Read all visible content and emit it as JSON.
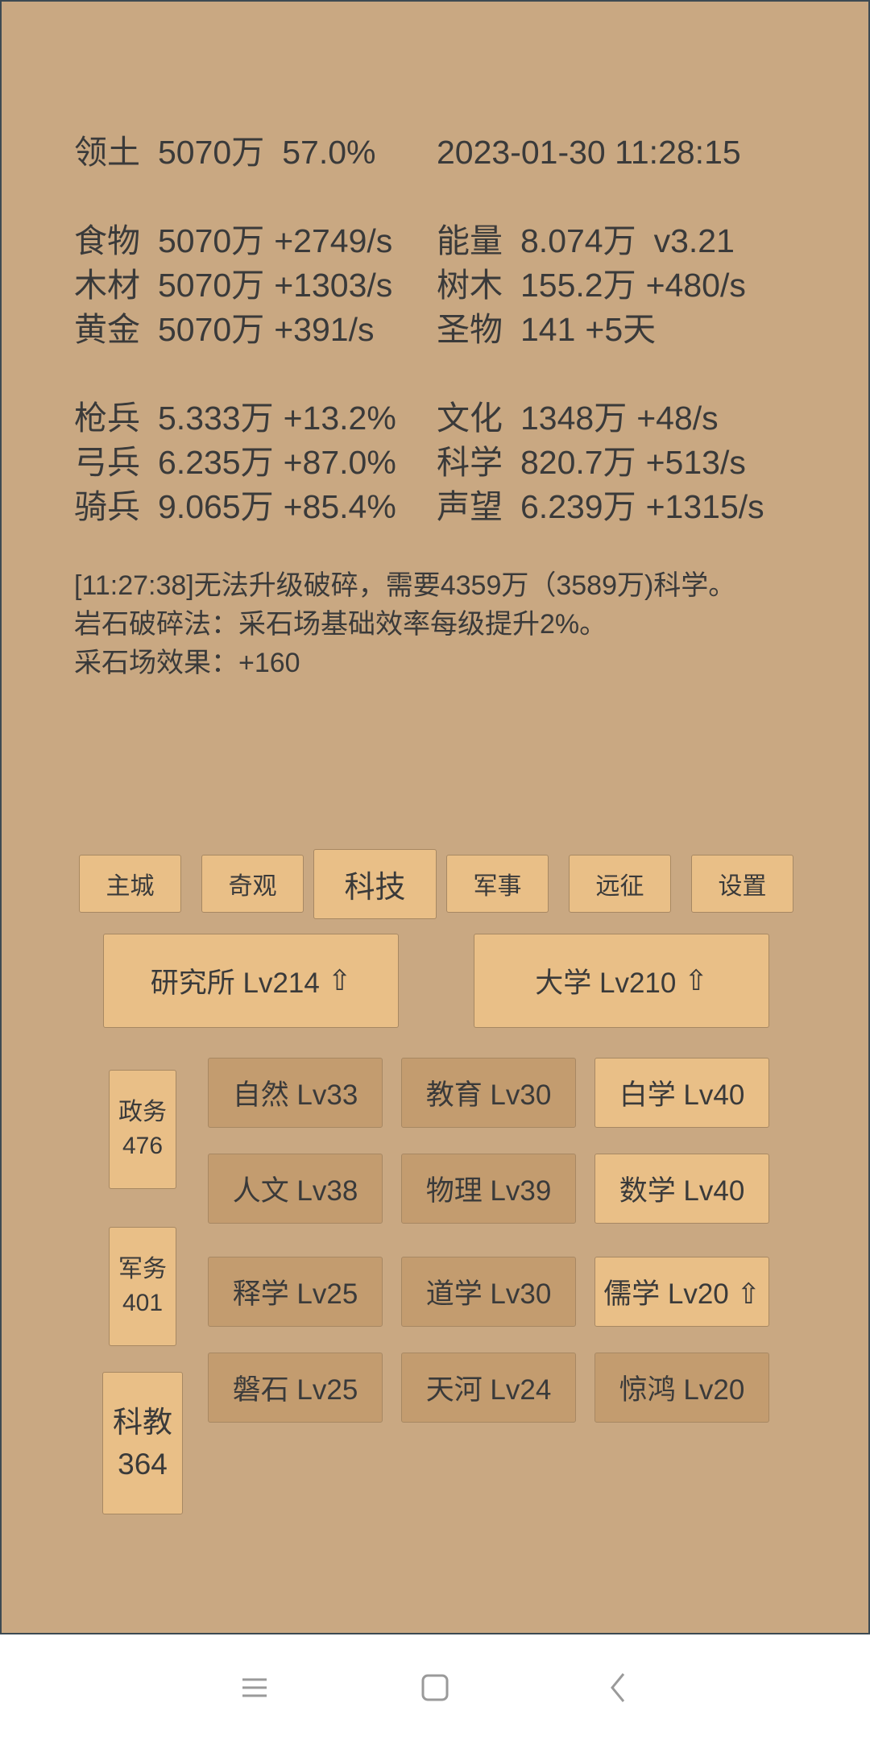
{
  "stats": {
    "territory": {
      "label": "领土",
      "value": "5070万",
      "percent": "57.0%"
    },
    "datetime": "2023-01-30 11:28:15",
    "left": [
      {
        "label": "食物",
        "value": "5070万",
        "rate": "+2749/s"
      },
      {
        "label": "木材",
        "value": "5070万",
        "rate": "+1303/s"
      },
      {
        "label": "黄金",
        "value": "5070万",
        "rate": "+391/s"
      },
      {
        "label": "枪兵",
        "value": "5.333万",
        "rate": "+13.2%"
      },
      {
        "label": "弓兵",
        "value": "6.235万",
        "rate": "+87.0%"
      },
      {
        "label": "骑兵",
        "value": "9.065万",
        "rate": "+85.4%"
      }
    ],
    "right": [
      {
        "label": "能量",
        "value": "8.074万",
        "rate": "v3.21"
      },
      {
        "label": "树木",
        "value": "155.2万",
        "rate": "+480/s"
      },
      {
        "label": "圣物",
        "value": "141",
        "rate": "+5天"
      },
      {
        "label": "文化",
        "value": "1348万",
        "rate": "+48/s"
      },
      {
        "label": "科学",
        "value": "820.7万",
        "rate": "+513/s"
      },
      {
        "label": "声望",
        "value": "6.239万",
        "rate": "+1315/s"
      }
    ]
  },
  "messages": [
    "[11:27:38]无法升级破碎，需要4359万（3589万)科学。",
    "岩石破碎法：采石场基础效率每级提升2%。",
    "采石场效果：+160"
  ],
  "tabs": [
    "主城",
    "奇观",
    "科技",
    "军事",
    "远征",
    "设置"
  ],
  "active_tab": "科技",
  "buildings": [
    {
      "name": "研究所 Lv214",
      "arrow": "⇧"
    },
    {
      "name": "大学 Lv210",
      "arrow": "⇧"
    }
  ],
  "side": [
    {
      "name": "政务",
      "count": "476"
    },
    {
      "name": "军务",
      "count": "401"
    },
    {
      "name": "科教",
      "count": "364"
    }
  ],
  "techs": [
    [
      "自然 Lv33",
      "教育 Lv30",
      "白学 Lv40"
    ],
    [
      "人文 Lv38",
      "物理 Lv39",
      "数学 Lv40"
    ],
    [
      "释学 Lv25",
      "道学 Lv30",
      "儒学 Lv20 ⇧"
    ],
    [
      "磐石 Lv25",
      "天河 Lv24",
      "惊鸿 Lv20"
    ]
  ],
  "nav": [
    "menu-icon",
    "home-icon",
    "back-icon"
  ],
  "colors": {
    "background": "#c9a882",
    "button": "#e9bf87",
    "button_dark": "#c39c6f",
    "text": "#3a3a3a"
  }
}
